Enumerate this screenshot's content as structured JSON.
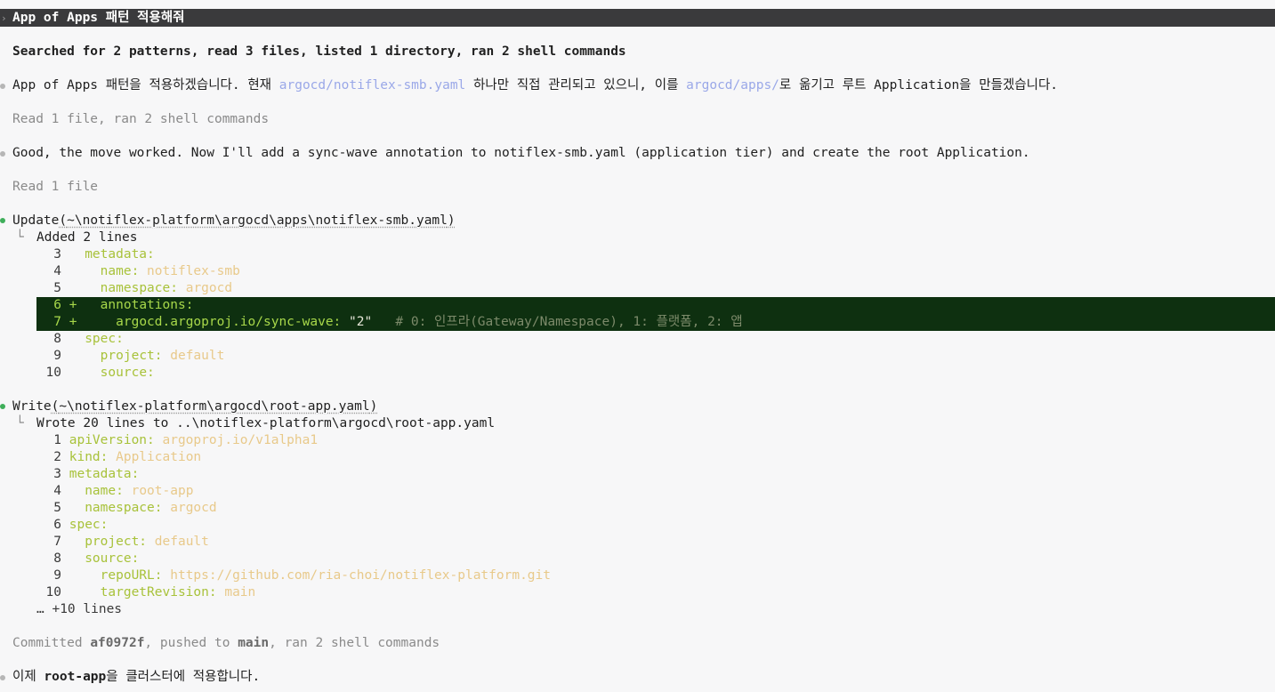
{
  "prompt": {
    "text": "App of Apps 패턴 적용해줘"
  },
  "summary1": "Searched for 2 patterns, read 3 files, listed 1 directory, ran 2 shell commands",
  "intro": {
    "p1": "App of Apps 패턴을 적용하겠습니다. 현재 ",
    "link1": "argocd/notiflex-smb.yaml",
    "p2": " 하나만 직접 관리되고 있으니, 이를 ",
    "link2": "argocd/apps/",
    "p3": "로 옮기고 루트 Application을 만들겠습니다."
  },
  "summary2": "Read 1 file, ran 2 shell commands",
  "move_msg": "Good, the move worked. Now I'll add a sync-wave annotation to notiflex-smb.yaml (application tier) and create the root Application.",
  "summary3": "Read 1 file",
  "update": {
    "label": "Update",
    "path": "~\\notiflex-platform\\argocd\\apps\\notiflex-smb.yaml",
    "result": "Added 2 lines",
    "lines": [
      {
        "n": "3",
        "indent": "",
        "key": "metadata:",
        "val": ""
      },
      {
        "n": "4",
        "indent": "  ",
        "key": "name:",
        "val": " notiflex-smb"
      },
      {
        "n": "5",
        "indent": "  ",
        "key": "namespace:",
        "val": " argocd"
      },
      {
        "n": "6",
        "indent": "  ",
        "key": "annotations:",
        "val": ""
      },
      {
        "n": "7",
        "indent": "    ",
        "key": "argocd.argoproj.io/sync-wave:",
        "val": " \"2\"",
        "comment": "   # 0: 인프라(Gateway/Namespace), 1: 플랫폼, 2: 앱"
      },
      {
        "n": "8",
        "indent": "",
        "key": "spec:",
        "val": ""
      },
      {
        "n": "9",
        "indent": "  ",
        "key": "project:",
        "val": " default"
      },
      {
        "n": "10",
        "indent": "  ",
        "key": "source:",
        "val": ""
      }
    ],
    "diff_marker": "+"
  },
  "write": {
    "label": "Write",
    "path": "~\\notiflex-platform\\argocd\\root-app.yaml",
    "result_prefix": "Wrote 20 lines to ",
    "result_path": "..\\notiflex-platform\\argocd\\root-app.yaml",
    "lines": [
      {
        "n": "1",
        "indent": "",
        "key": "apiVersion:",
        "val": " argoproj.io/v1alpha1"
      },
      {
        "n": "2",
        "indent": "",
        "key": "kind:",
        "val": " Application"
      },
      {
        "n": "3",
        "indent": "",
        "key": "metadata:",
        "val": ""
      },
      {
        "n": "4",
        "indent": "  ",
        "key": "name:",
        "val": " root-app"
      },
      {
        "n": "5",
        "indent": "  ",
        "key": "namespace:",
        "val": " argocd"
      },
      {
        "n": "6",
        "indent": "",
        "key": "spec:",
        "val": ""
      },
      {
        "n": "7",
        "indent": "  ",
        "key": "project:",
        "val": " default"
      },
      {
        "n": "8",
        "indent": "  ",
        "key": "source:",
        "val": ""
      },
      {
        "n": "9",
        "indent": "    ",
        "key": "repoURL:",
        "val": " https://github.com/ria-choi/notiflex-platform.git"
      },
      {
        "n": "10",
        "indent": "    ",
        "key": "targetRevision:",
        "val": " main"
      }
    ],
    "more": "… +10 lines"
  },
  "commit": {
    "p1": "Committed ",
    "hash": "af0972f",
    "p2": ", pushed to ",
    "branch": "main",
    "p3": ", ran 2 shell commands"
  },
  "final": {
    "p1": "이제 ",
    "app": "root-app",
    "p2": "을 클러스터에 적용합니다."
  },
  "colors": {
    "prompt_bg": "#3a3a3c",
    "accent_green": "#3fae5a",
    "diff_bg": "#0e3010",
    "link": "#9aa8e8"
  }
}
